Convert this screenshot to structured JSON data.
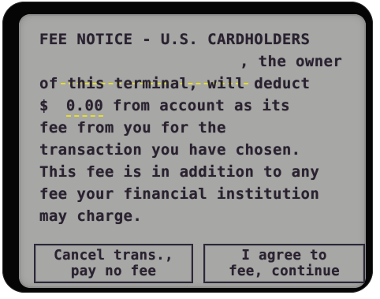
{
  "notice": {
    "title": "FEE NOTICE - U.S. CARDHOLDERS",
    "line_owner_suffix": ", the owner",
    "line_terminal": "of this terminal, will deduct",
    "currency_symbol": "$",
    "fee_amount": "0.00",
    "line_fee_suffix": " from account as its",
    "line_fee_from": "fee from you for the",
    "line_transaction": "transaction you have chosen.",
    "line_addition": "This fee is in addition to any",
    "line_institution": "fee your financial institution",
    "line_may_charge": "may charge."
  },
  "buttons": {
    "cancel_line1": "Cancel trans.,",
    "cancel_line2": "pay no fee",
    "agree_line1": "I agree to",
    "agree_line2": "fee, continue"
  },
  "colors": {
    "screen_background": "#a7a7a5",
    "text": "#2a2230",
    "blank_underline": "#e5df28",
    "bezel": "#050505"
  }
}
